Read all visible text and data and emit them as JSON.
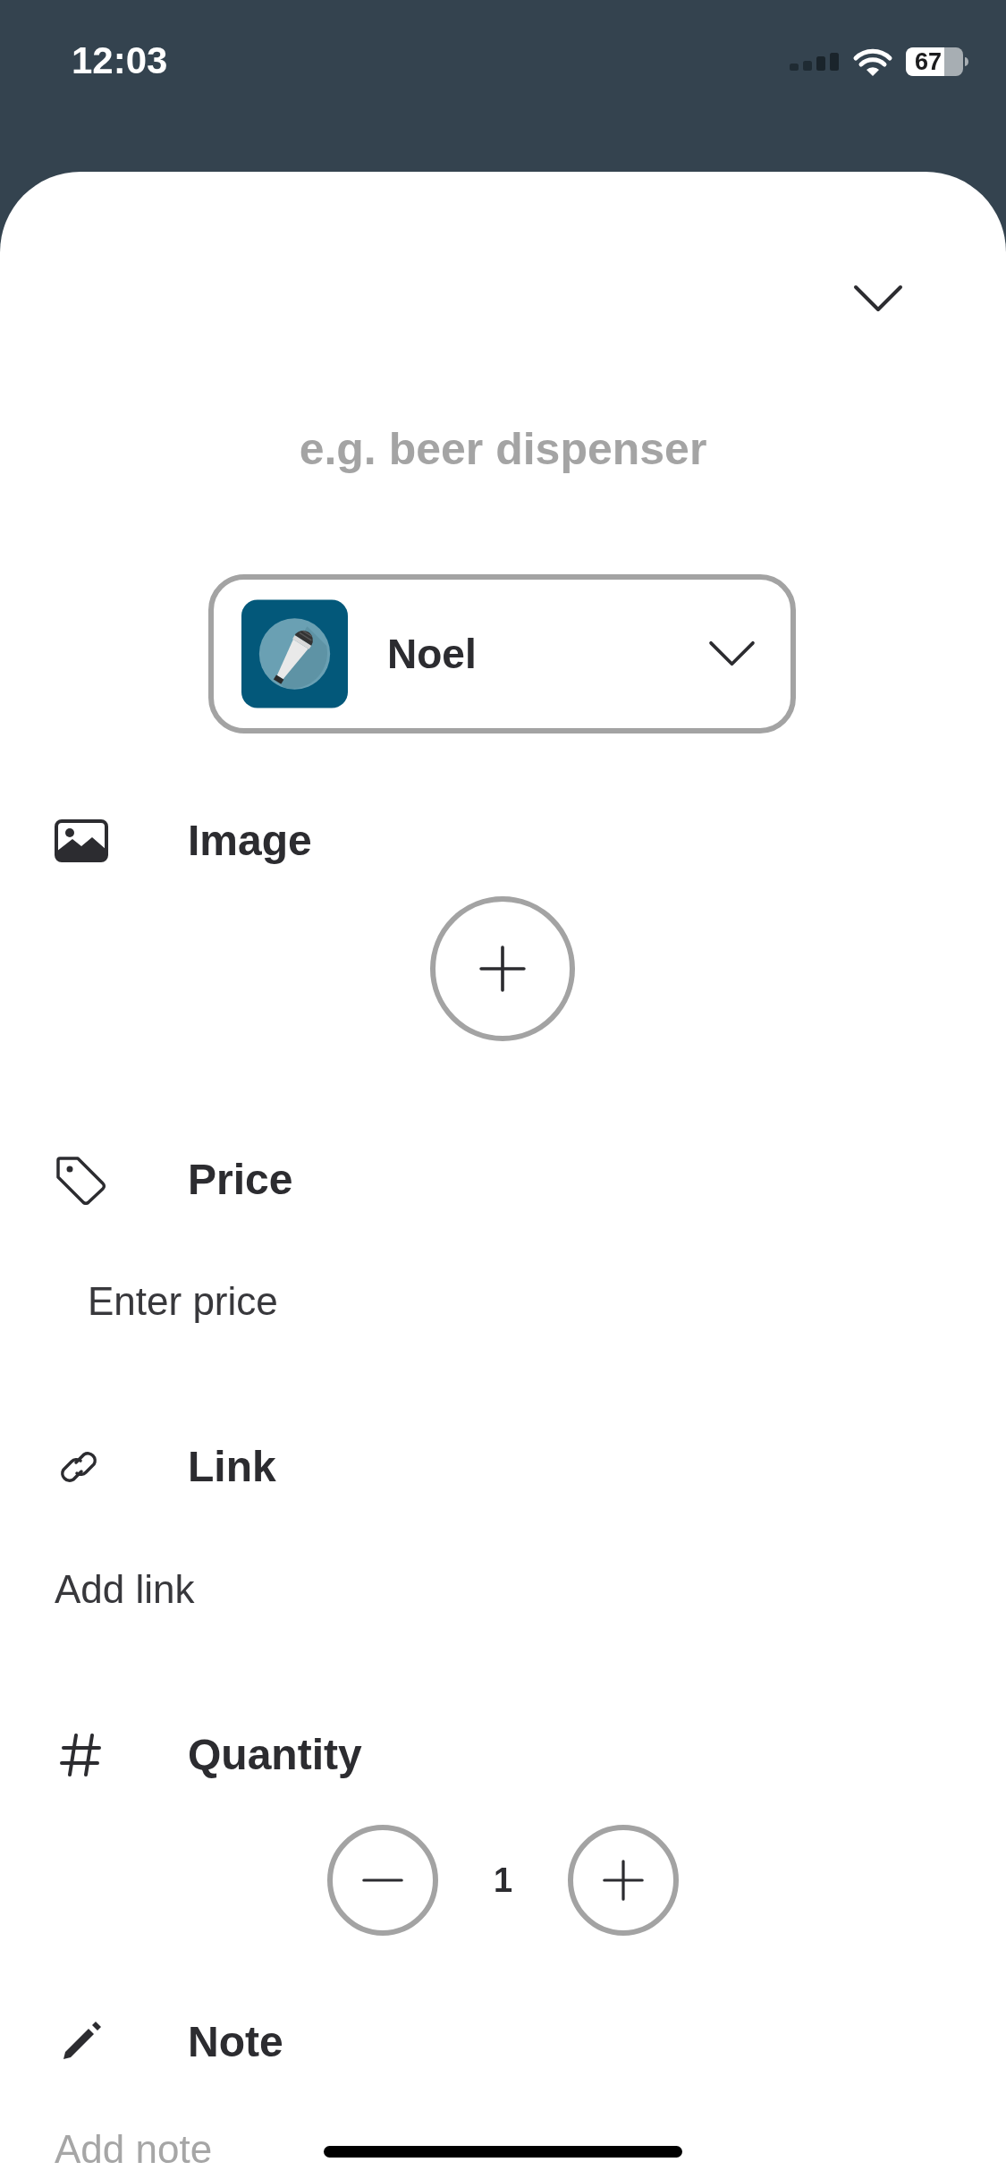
{
  "status_bar": {
    "time": "12:03",
    "battery": "67"
  },
  "title_field": {
    "placeholder": "e.g. beer dispenser"
  },
  "list_picker": {
    "value": "Noel"
  },
  "sections": [
    {
      "kind": "image",
      "label": "Image"
    },
    {
      "kind": "price",
      "label": "Price",
      "placeholder": "Enter price"
    },
    {
      "kind": "link",
      "label": "Link",
      "placeholder": "Add link"
    },
    {
      "kind": "quantity",
      "label": "Quantity",
      "value": "1"
    },
    {
      "kind": "note",
      "label": "Note",
      "placeholder": "Add note"
    }
  ]
}
